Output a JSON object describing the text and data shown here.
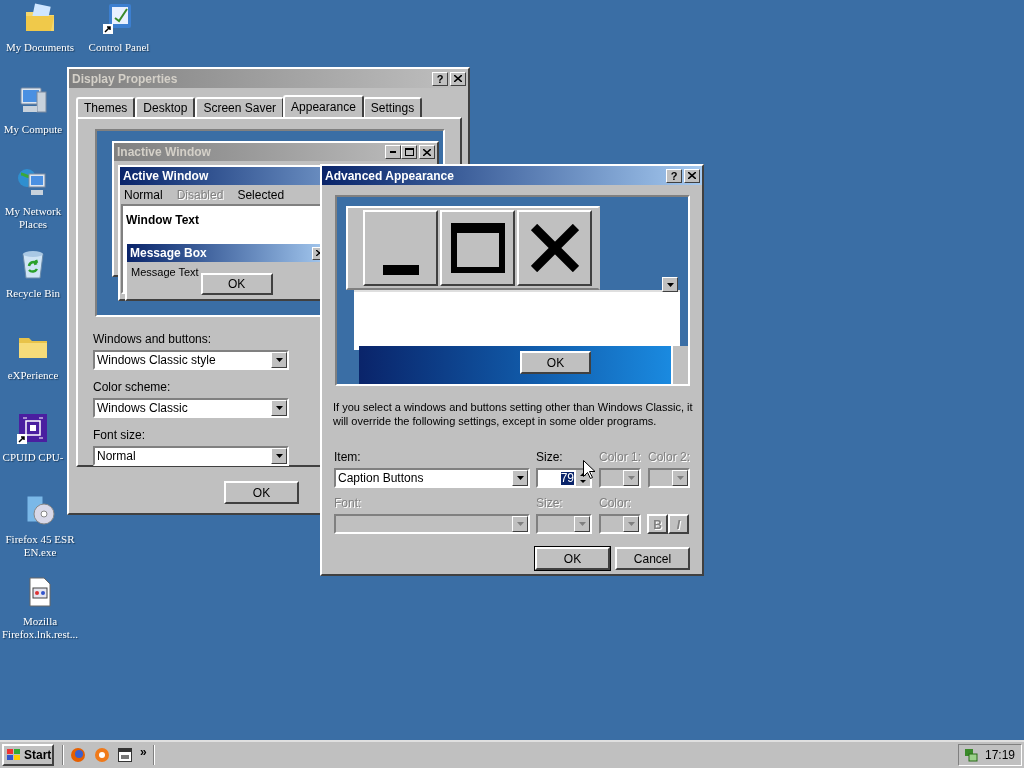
{
  "desktop_icons": [
    {
      "label": "My Documents",
      "kind": "documents"
    },
    {
      "label": "Control Panel",
      "kind": "control-panel"
    },
    {
      "label": "My Compute",
      "kind": "computer"
    },
    {
      "label": "My Network Places",
      "kind": "network"
    },
    {
      "label": "Recycle Bin",
      "kind": "recycle"
    },
    {
      "label": "eXPerience",
      "kind": "folder"
    },
    {
      "label": "CPUID CPU-",
      "kind": "chip"
    },
    {
      "label": "Firefox 45 ESR EN.exe",
      "kind": "installer"
    },
    {
      "label": "Mozilla Firefox.lnk.rest...",
      "kind": "file"
    }
  ],
  "display_properties": {
    "title": "Display Properties",
    "active": false,
    "help": "?",
    "tabs": [
      {
        "label": "Themes",
        "selected": false
      },
      {
        "label": "Desktop",
        "selected": false
      },
      {
        "label": "Screen Saver",
        "selected": false
      },
      {
        "label": "Appearance",
        "selected": true
      },
      {
        "label": "Settings",
        "selected": false
      }
    ],
    "preview": {
      "inactive_title": "Inactive Window",
      "active_title": "Active Window",
      "menu": [
        {
          "label": "Normal",
          "disabled": false
        },
        {
          "label": "Disabled",
          "disabled": true
        },
        {
          "label": "Selected",
          "disabled": false
        }
      ],
      "window_text": "Window Text",
      "message_title": "Message Box",
      "message_text": "Message Text",
      "button": "OK"
    },
    "fields": [
      {
        "label": "Windows and buttons:",
        "value": "Windows Classic style"
      },
      {
        "label": "Color scheme:",
        "value": "Windows Classic"
      },
      {
        "label": "Font size:",
        "value": "Normal"
      }
    ],
    "buttons": [
      "OK"
    ]
  },
  "advanced": {
    "title": "Advanced Appearance",
    "active": true,
    "help": "?",
    "preview": {
      "button": "OK"
    },
    "notice": "If you select a windows and buttons setting other than Windows Classic, it will override the following settings, except in some older programs.",
    "item": {
      "label": "Item:",
      "value": "Caption Buttons"
    },
    "size": {
      "label": "Size:",
      "value": "79",
      "selected": true
    },
    "color1": {
      "label": "Color 1:",
      "disabled": true
    },
    "color2": {
      "label": "Color 2:",
      "disabled": true
    },
    "font": {
      "label": "Font:",
      "disabled": true
    },
    "font_size": {
      "label": "Size:",
      "disabled": true
    },
    "font_color": {
      "label": "Color:",
      "disabled": true
    },
    "bold": {
      "label": "B",
      "disabled": true
    },
    "italic": {
      "label": "I",
      "disabled": true
    },
    "buttons": [
      {
        "label": "OK",
        "default": true
      },
      {
        "label": "Cancel",
        "default": false
      }
    ]
  },
  "taskbar": {
    "start": "Start",
    "quick_launch": [
      {
        "kind": "firefox"
      },
      {
        "kind": "orange-circle"
      },
      {
        "kind": "window"
      }
    ],
    "chevron": "»",
    "clock": "17:19"
  }
}
